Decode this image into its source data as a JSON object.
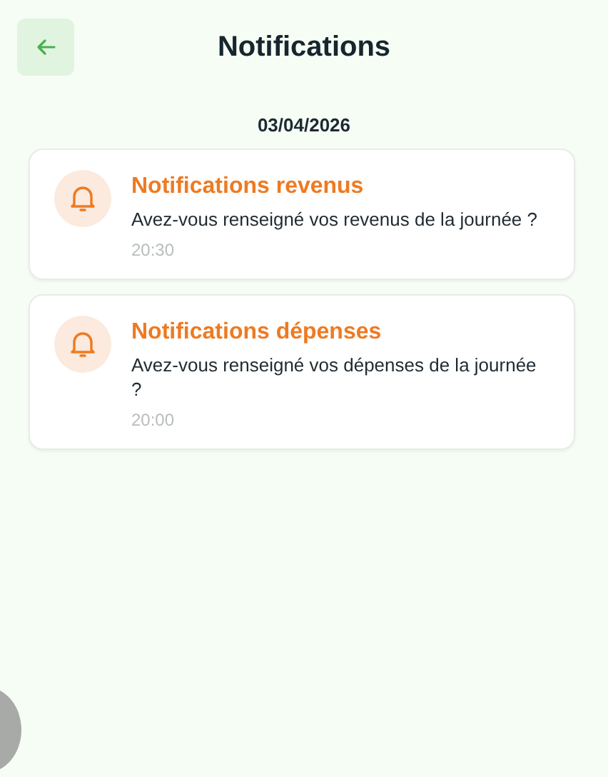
{
  "header": {
    "title": "Notifications"
  },
  "date": "03/04/2026",
  "notifications": [
    {
      "title": "Notifications revenus",
      "message": "Avez-vous renseigné vos revenus de la journée ?",
      "time": "20:30"
    },
    {
      "title": "Notifications dépenses",
      "message": "Avez-vous renseigné vos dépenses de la journée ?",
      "time": "20:00"
    }
  ]
}
